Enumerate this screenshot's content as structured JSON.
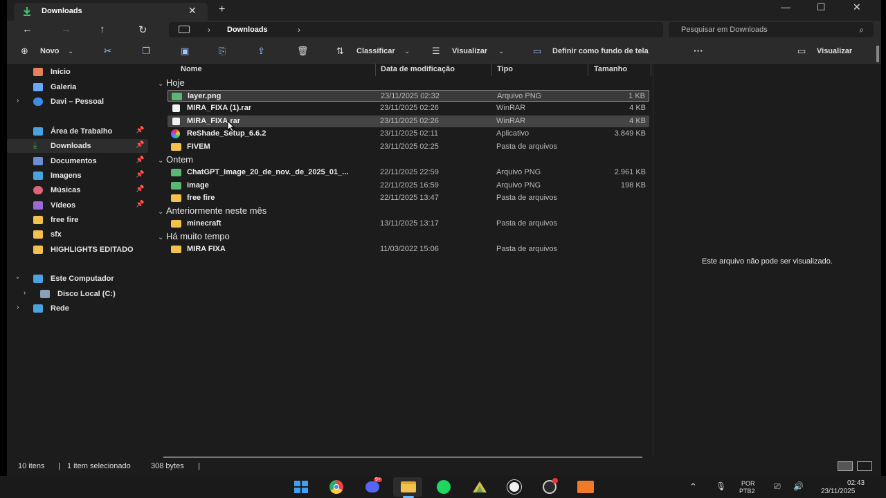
{
  "tab": {
    "title": "Downloads",
    "icon": "download-icon"
  },
  "address": {
    "location": "Downloads",
    "search_placeholder": "Pesquisar em Downloads"
  },
  "commands": {
    "new": "Novo",
    "sort": "Classificar",
    "view": "Visualizar",
    "set_wallpaper": "Definir como fundo de tela",
    "more": "···",
    "preview": "Visualizar"
  },
  "sidebar": {
    "items": [
      {
        "label": "Início",
        "icon": "home-icon",
        "color": "#e8805a"
      },
      {
        "label": "Galeria",
        "icon": "gallery-icon",
        "color": "#6aa8ff"
      },
      {
        "label": "Davi – Pessoal",
        "icon": "onedrive-icon",
        "color": "#3a8ee6"
      },
      {
        "label": "Área de Trabalho",
        "icon": "desktop-icon",
        "color": "#4aa3df"
      },
      {
        "label": "Downloads",
        "icon": "download-icon",
        "color": "#3ec46d"
      },
      {
        "label": "Documentos",
        "icon": "documents-icon",
        "color": "#6a8fd6"
      },
      {
        "label": "Imagens",
        "icon": "pictures-icon",
        "color": "#4aa3df"
      },
      {
        "label": "Músicas",
        "icon": "music-icon",
        "color": "#e0637a"
      },
      {
        "label": "Vídeos",
        "icon": "videos-icon",
        "color": "#9b6ad6"
      },
      {
        "label": "free fire",
        "icon": "folder-icon",
        "color": "#f3c14e"
      },
      {
        "label": "sfx",
        "icon": "folder-icon",
        "color": "#f3c14e"
      },
      {
        "label": "HIGHLIGHTS EDITADO",
        "icon": "folder-icon",
        "color": "#f3c14e"
      },
      {
        "label": "Este Computador",
        "icon": "computer-icon",
        "color": "#4aa3df"
      },
      {
        "label": "Disco Local (C:)",
        "icon": "drive-icon",
        "color": "#8aa0b8"
      },
      {
        "label": "Rede",
        "icon": "network-icon",
        "color": "#4aa3df"
      }
    ]
  },
  "columns": {
    "name": "Nome",
    "date": "Data de modificação",
    "type": "Tipo",
    "size": "Tamanho"
  },
  "groups": {
    "today": "Hoje",
    "yesterday": "Ontem",
    "earlier_month": "Anteriormente neste mês",
    "long_ago": "Há muito tempo"
  },
  "files": [
    {
      "name": "layer.png",
      "date": "23/11/2025 02:32",
      "type": "Arquivo PNG",
      "size": "1 KB",
      "icon": "image-file-icon"
    },
    {
      "name": "MIRA_FIXA (1).rar",
      "date": "23/11/2025 02:26",
      "type": "WinRAR",
      "size": "4 KB",
      "icon": "file-icon"
    },
    {
      "name": "MIRA_FIXA.rar",
      "date": "23/11/2025 02:26",
      "type": "WinRAR",
      "size": "4 KB",
      "icon": "file-icon"
    },
    {
      "name": "ReShade_Setup_6.6.2",
      "date": "23/11/2025 02:11",
      "type": "Aplicativo",
      "size": "3.849 KB",
      "icon": "app-icon"
    },
    {
      "name": "FIVEM",
      "date": "23/11/2025 02:25",
      "type": "Pasta de arquivos",
      "size": "",
      "icon": "folder-icon"
    },
    {
      "name": "ChatGPT_Image_20_de_nov._de_2025_01_...",
      "date": "22/11/2025 22:59",
      "type": "Arquivo PNG",
      "size": "2.961 KB",
      "icon": "image-file-icon"
    },
    {
      "name": "image",
      "date": "22/11/2025 16:59",
      "type": "Arquivo PNG",
      "size": "198 KB",
      "icon": "image-file-icon"
    },
    {
      "name": "free fire",
      "date": "22/11/2025 13:47",
      "type": "Pasta de arquivos",
      "size": "",
      "icon": "folder-icon"
    },
    {
      "name": "minecraft",
      "date": "13/11/2025 13:17",
      "type": "Pasta de arquivos",
      "size": "",
      "icon": "folder-icon"
    },
    {
      "name": "MIRA FIXA",
      "date": "11/03/2022 15:06",
      "type": "Pasta de arquivos",
      "size": "",
      "icon": "folder-icon"
    }
  ],
  "preview_message": "Este arquivo não pode ser visualizado.",
  "status": {
    "count": "10 itens",
    "selected": "1 item selecionado",
    "bytes": "308 bytes"
  },
  "taskbar": {
    "lang_top": "POR",
    "lang_bottom": "PTB2",
    "time": "02:43",
    "date": "23/11/2025",
    "discord_badge": "9+"
  },
  "colors": {
    "folder": "#f3c14e",
    "accent": "#3ec46d",
    "png": "#5bb872"
  }
}
